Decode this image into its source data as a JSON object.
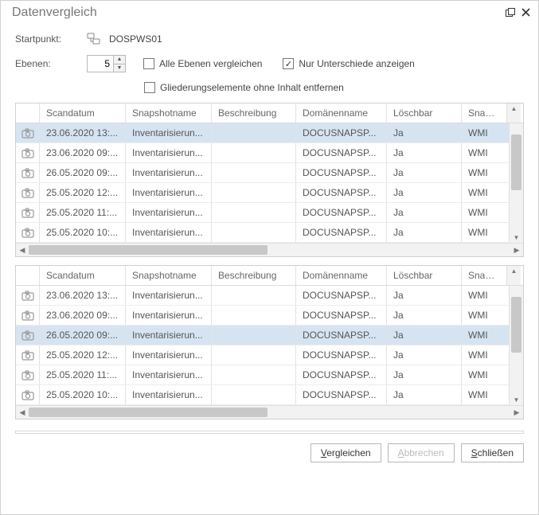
{
  "title": "Datenvergleich",
  "form": {
    "startpoint_label": "Startpunkt:",
    "startpoint_value": "DOSPWS01",
    "levels_label": "Ebenen:",
    "levels_value": "5",
    "cb_all_levels": "Alle Ebenen vergleichen",
    "cb_all_levels_checked": false,
    "cb_only_diff": "Nur Unterschiede anzeigen",
    "cb_only_diff_checked": true,
    "cb_remove_empty": "Gliederungselemente ohne Inhalt entfernen",
    "cb_remove_empty_checked": false
  },
  "columns": {
    "scandatum": "Scandatum",
    "snapshotname": "Snapshotname",
    "beschreibung": "Beschreibung",
    "domaenenname": "Domänenname",
    "loeschbar": "Löschbar",
    "snapshot_trunc": "Snapsh"
  },
  "grid1": {
    "selected": 0,
    "rows": [
      {
        "date": "23.06.2020 13:",
        "snap": "Inventarisierun...",
        "desc": "",
        "dom": "DOCUSNAPSP...",
        "del": "Ja",
        "type": "WMI"
      },
      {
        "date": "23.06.2020 09:",
        "snap": "Inventarisierun...",
        "desc": "",
        "dom": "DOCUSNAPSP...",
        "del": "Ja",
        "type": "WMI"
      },
      {
        "date": "26.05.2020 09:",
        "snap": "Inventarisierun...",
        "desc": "",
        "dom": "DOCUSNAPSP...",
        "del": "Ja",
        "type": "WMI"
      },
      {
        "date": "25.05.2020 12:",
        "snap": "Inventarisierun...",
        "desc": "",
        "dom": "DOCUSNAPSP...",
        "del": "Ja",
        "type": "WMI"
      },
      {
        "date": "25.05.2020 11:",
        "snap": "Inventarisierun...",
        "desc": "",
        "dom": "DOCUSNAPSP...",
        "del": "Ja",
        "type": "WMI"
      },
      {
        "date": "25.05.2020 10:",
        "snap": "Inventarisierun...",
        "desc": "",
        "dom": "DOCUSNAPSP...",
        "del": "Ja",
        "type": "WMI"
      }
    ]
  },
  "grid2": {
    "selected": 2,
    "rows": [
      {
        "date": "23.06.2020 13:",
        "snap": "Inventarisierun...",
        "desc": "",
        "dom": "DOCUSNAPSP...",
        "del": "Ja",
        "type": "WMI"
      },
      {
        "date": "23.06.2020 09:",
        "snap": "Inventarisierun...",
        "desc": "",
        "dom": "DOCUSNAPSP...",
        "del": "Ja",
        "type": "WMI"
      },
      {
        "date": "26.05.2020 09:",
        "snap": "Inventarisierun...",
        "desc": "",
        "dom": "DOCUSNAPSP...",
        "del": "Ja",
        "type": "WMI"
      },
      {
        "date": "25.05.2020 12:",
        "snap": "Inventarisierun...",
        "desc": "",
        "dom": "DOCUSNAPSP...",
        "del": "Ja",
        "type": "WMI"
      },
      {
        "date": "25.05.2020 11:",
        "snap": "Inventarisierun...",
        "desc": "",
        "dom": "DOCUSNAPSP...",
        "del": "Ja",
        "type": "WMI"
      },
      {
        "date": "25.05.2020 10:",
        "snap": "Inventarisierun...",
        "desc": "",
        "dom": "DOCUSNAPSP...",
        "del": "Ja",
        "type": "WMI"
      }
    ]
  },
  "buttons": {
    "compare": "Vergleichen",
    "compare_u": "V",
    "compare_rest": "ergleichen",
    "cancel": "Abbrechen",
    "cancel_u": "A",
    "cancel_rest": "bbrechen",
    "close": "Schließen",
    "close_u": "S",
    "close_rest": "chließen"
  }
}
